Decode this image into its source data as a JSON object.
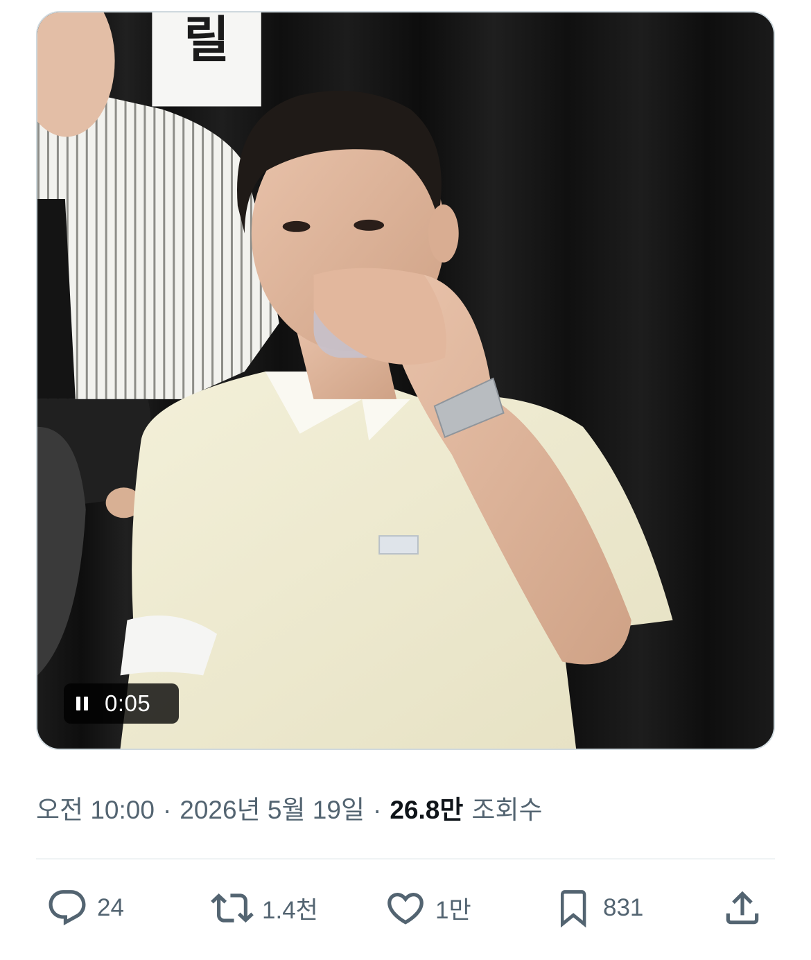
{
  "video": {
    "timestamp": "0:05",
    "state_icon": "pause-icon",
    "background_sign_text": "릴"
  },
  "meta": {
    "time": "오전 10:00",
    "separator": "·",
    "date": "2026년 5월 19일",
    "views_count": "26.8만",
    "views_label": "조회수"
  },
  "actions": {
    "reply": {
      "icon": "reply-icon",
      "count": "24"
    },
    "repost": {
      "icon": "repost-icon",
      "count": "1.4천"
    },
    "like": {
      "icon": "heart-icon",
      "count": "1만"
    },
    "bookmark": {
      "icon": "bookmark-icon",
      "count": "831"
    },
    "share": {
      "icon": "share-icon"
    }
  },
  "colors": {
    "text_secondary": "#536471",
    "text_primary": "#0f1419",
    "border": "#cfd9de",
    "divider": "#eff3f4"
  }
}
